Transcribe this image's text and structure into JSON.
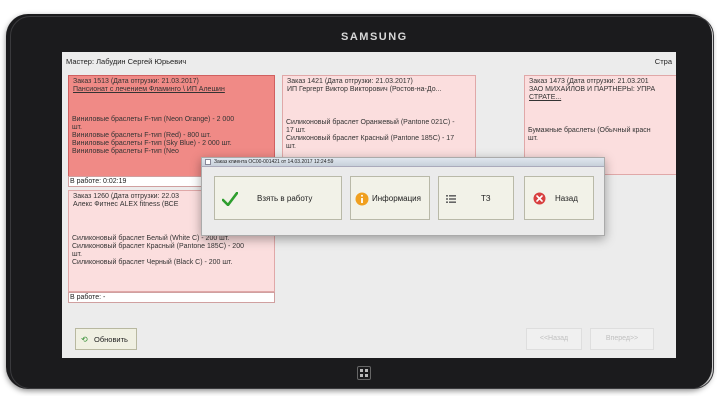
{
  "device": {
    "brand": "SAMSUNG"
  },
  "header": {
    "master": "Мастер: Лабудин Сергей Юрьевич",
    "right_text": "Стра"
  },
  "cards": {
    "c1513": {
      "title": "Заказ 1513 (Дата отгрузки: 21.03.2017)",
      "client": "Пансионат с лечением Фламинго \\ ИП Алешин",
      "items": [
        "Виниловые браслеты F-тип (Neon Orange) - 2 000",
        "шт.",
        "Виниловые браслеты F-тип (Red) - 800 шт.",
        "Виниловые браслеты F-тип (Sky Blue) - 2 000 шт.",
        "Виниловые браслеты F-тип (Neo"
      ],
      "status": "В работе: 0:02:19"
    },
    "c1421": {
      "title": "Заказ 1421 (Дата отгрузки: 21.03.2017)",
      "client": "ИП Гергерт Виктор Викторович (Ростов-на-До...",
      "items": [
        "Силиконовый браслет Оранжевый (Pantone 021C) -",
        "17 шт.",
        "Силиконовый браслет Красный (Pantone 185C) - 17",
        "шт."
      ]
    },
    "c1473": {
      "title": "Заказ 1473 (Дата отгрузки: 21.03.201",
      "client": "ЗАО МИХАЙЛОВ И ПАРТНЕРЫ: УПРА",
      "client2": "СТРАТЕ...",
      "items": [
        "Бумажные браслеты (Обычный красн",
        "шт."
      ]
    },
    "c1260": {
      "title": "Заказ 1260 (Дата отгрузки: 22.03",
      "client": "Алекс Фитнес ALEX fitness (ВСЕ",
      "items": [
        "Силиконовый браслет Белый (White C) - 200 шт.",
        "Силиконовый браслет Красный (Pantone 185C) - 200",
        "шт.",
        "Силиконовый браслет Черный (Black C) - 200 шт."
      ],
      "status": "В работе: -"
    }
  },
  "dialog": {
    "title": "Заказ клиента ОС00-001421 от 14.03.2017 12:24:59",
    "buttons": {
      "take": {
        "label": "Взять в работу",
        "icon": "checkmark-icon"
      },
      "info": {
        "label": "Информация",
        "icon": "info-icon"
      },
      "spec": {
        "label": "ТЗ",
        "icon": "list-icon"
      },
      "back": {
        "label": "Назад",
        "icon": "close-icon"
      }
    }
  },
  "footer": {
    "refresh": "Обновить",
    "prev": "<<Назад",
    "next": "Вперед>>"
  },
  "colors": {
    "card_red": "#f08a86",
    "card_pink": "#fbdede",
    "check_green": "#2e9e2e",
    "info_orange": "#f0a020",
    "close_red": "#d84040"
  }
}
